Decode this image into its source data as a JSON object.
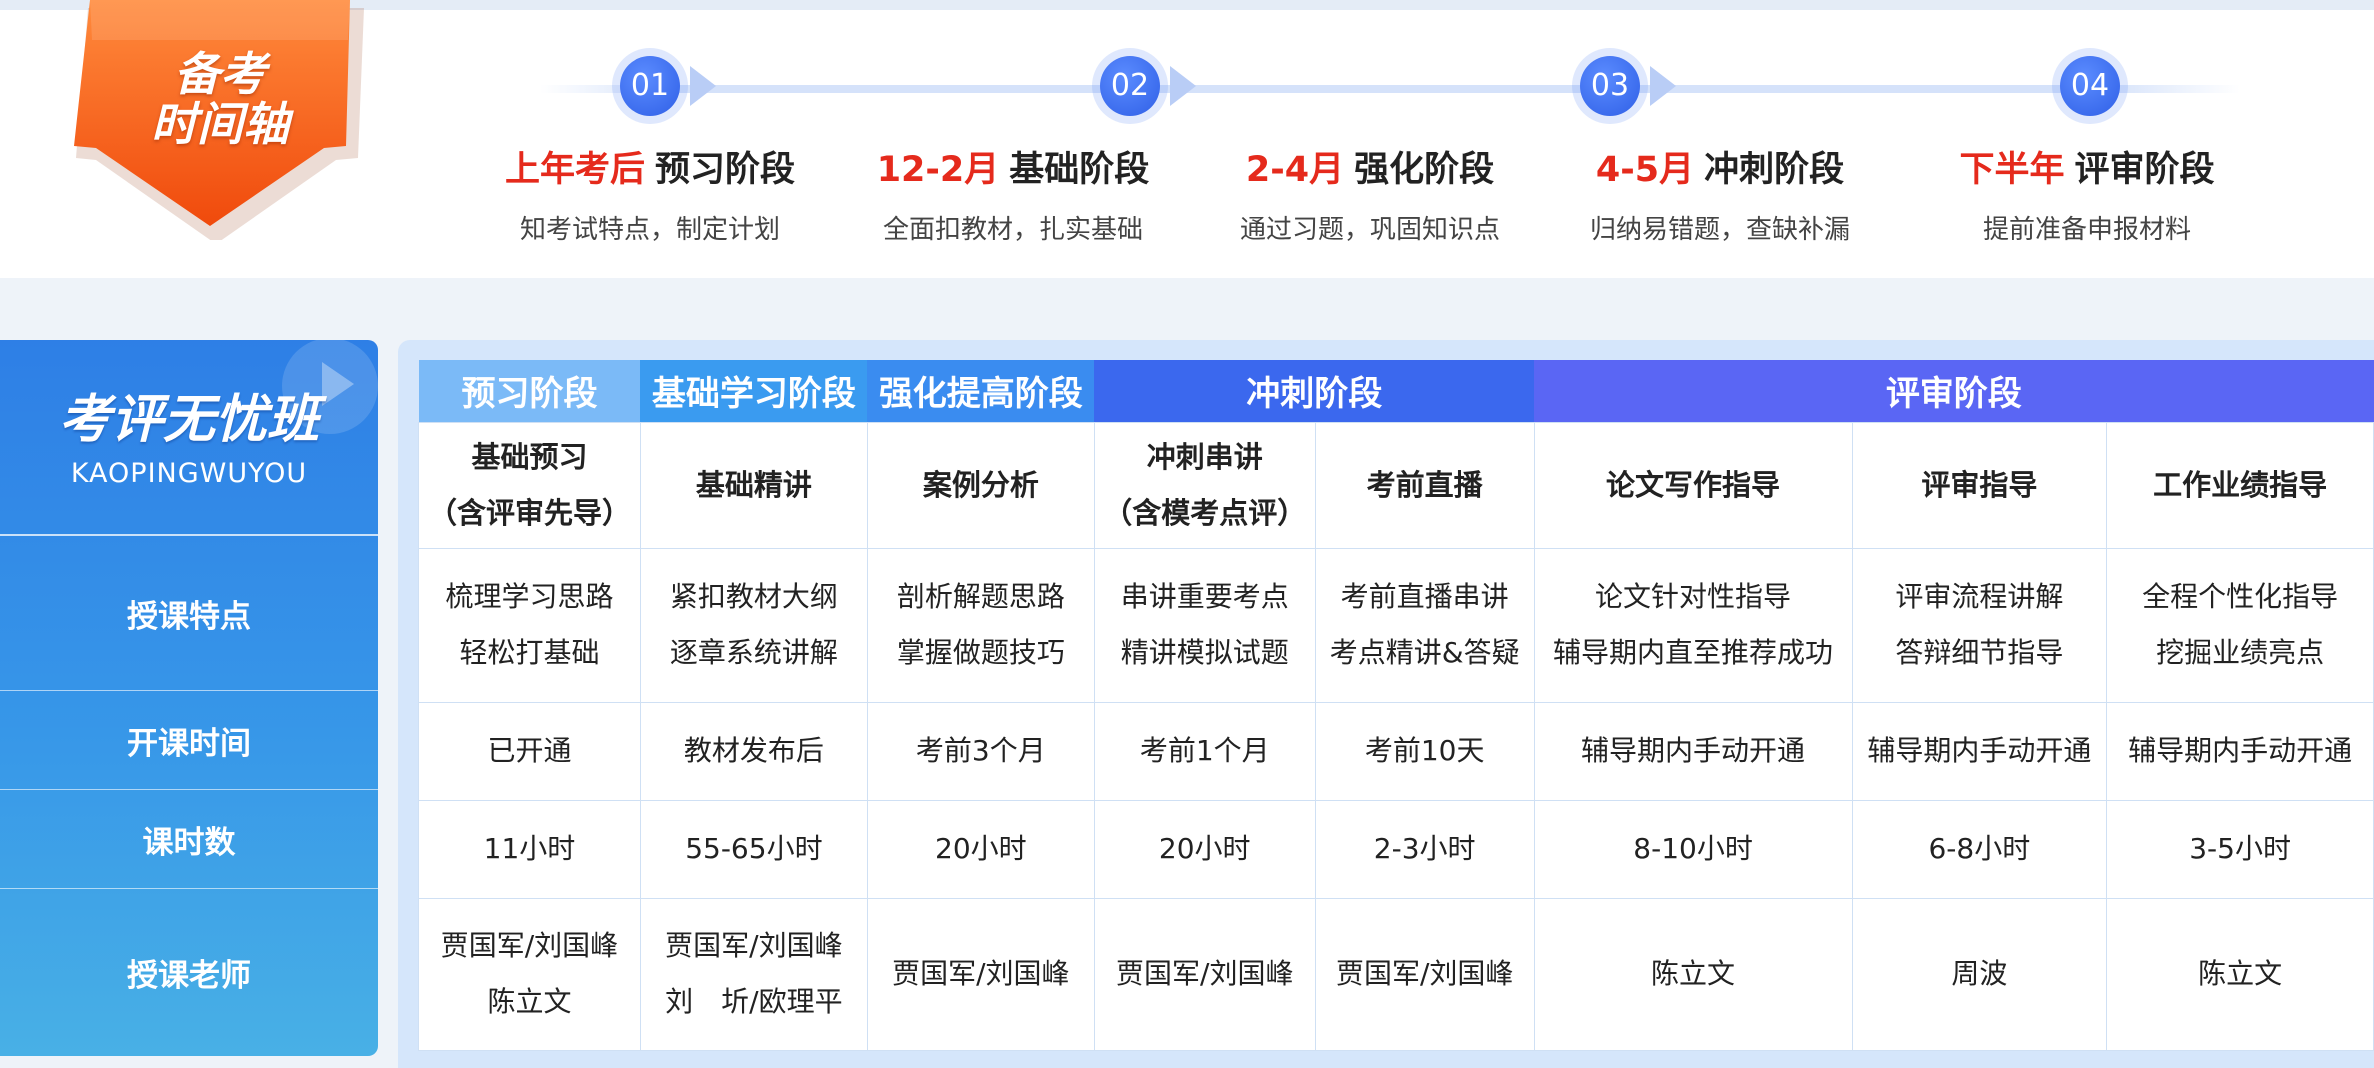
{
  "badge": {
    "line1": "备考",
    "line2": "时间轴"
  },
  "timeline": [
    {
      "num": "01",
      "time": "上年考后",
      "name": "预习阶段",
      "desc": "知考试特点，制定计划"
    },
    {
      "num": "02",
      "time": "12-2月",
      "name": "基础阶段",
      "desc": "全面扣教材，扎实基础"
    },
    {
      "num": "03",
      "time": "2-4月",
      "name": "强化阶段",
      "desc": "通过习题，巩固知识点"
    },
    {
      "num": "",
      "time": "4-5月",
      "name": "冲刺阶段",
      "desc": "归纳易错题，查缺补漏"
    },
    {
      "num": "04",
      "time": "下半年",
      "name": "评审阶段",
      "desc": "提前准备申报材料"
    }
  ],
  "brand": {
    "title": "考评无忧班",
    "subtitle": "KAOPINGWUYOU"
  },
  "row_labels": [
    "授课特点",
    "开课时间",
    "课时数",
    "授课老师"
  ],
  "stages": [
    "预习阶段",
    "基础学习阶段",
    "强化提高阶段",
    "冲刺阶段",
    "评审阶段"
  ],
  "columns": [
    {
      "name": [
        "基础预习",
        "（含评审先导）"
      ],
      "features": [
        "梳理学习思路",
        "轻松打基础"
      ],
      "start": "已开通",
      "hours": "11小时",
      "teachers": [
        "贾国军/刘国峰",
        "陈立文"
      ]
    },
    {
      "name": [
        "基础精讲"
      ],
      "features": [
        "紧扣教材大纲",
        "逐章系统讲解"
      ],
      "start": "教材发布后",
      "hours": "55-65小时",
      "teachers": [
        "贾国军/刘国峰",
        "刘　圻/欧理平"
      ]
    },
    {
      "name": [
        "案例分析"
      ],
      "features": [
        "剖析解题思路",
        "掌握做题技巧"
      ],
      "start": "考前3个月",
      "hours": "20小时",
      "teachers": [
        "贾国军/刘国峰"
      ]
    },
    {
      "name": [
        "冲刺串讲",
        "（含模考点评）"
      ],
      "features": [
        "串讲重要考点",
        "精讲模拟试题"
      ],
      "start": "考前1个月",
      "hours": "20小时",
      "teachers": [
        "贾国军/刘国峰"
      ]
    },
    {
      "name": [
        "考前直播"
      ],
      "features": [
        "考前直播串讲",
        "考点精讲&答疑"
      ],
      "start": "考前10天",
      "hours": "2-3小时",
      "teachers": [
        "贾国军/刘国峰"
      ]
    },
    {
      "name": [
        "论文写作指导"
      ],
      "features": [
        "论文针对性指导",
        "辅导期内直至推荐成功"
      ],
      "start": "辅导期内手动开通",
      "hours": "8-10小时",
      "teachers": [
        "陈立文"
      ]
    },
    {
      "name": [
        "评审指导"
      ],
      "features": [
        "评审流程讲解",
        "答辩细节指导"
      ],
      "start": "辅导期内手动开通",
      "hours": "6-8小时",
      "teachers": [
        "周波"
      ]
    },
    {
      "name": [
        "工作业绩指导"
      ],
      "features": [
        "全程个性化指导",
        "挖掘业绩亮点"
      ],
      "start": "辅导期内手动开通",
      "hours": "3-5小时",
      "teachers": [
        "陈立文"
      ]
    }
  ],
  "colors": {
    "stage_preview": "#7bbaf7",
    "stage_basic": "#3a9bf0",
    "stage_strengthen": "#3a8cf0",
    "stage_sprint": "#3b68ee",
    "stage_review": "#5a66f4",
    "accent_red": "#e52a1c",
    "badge_orange": "#f55a12"
  }
}
